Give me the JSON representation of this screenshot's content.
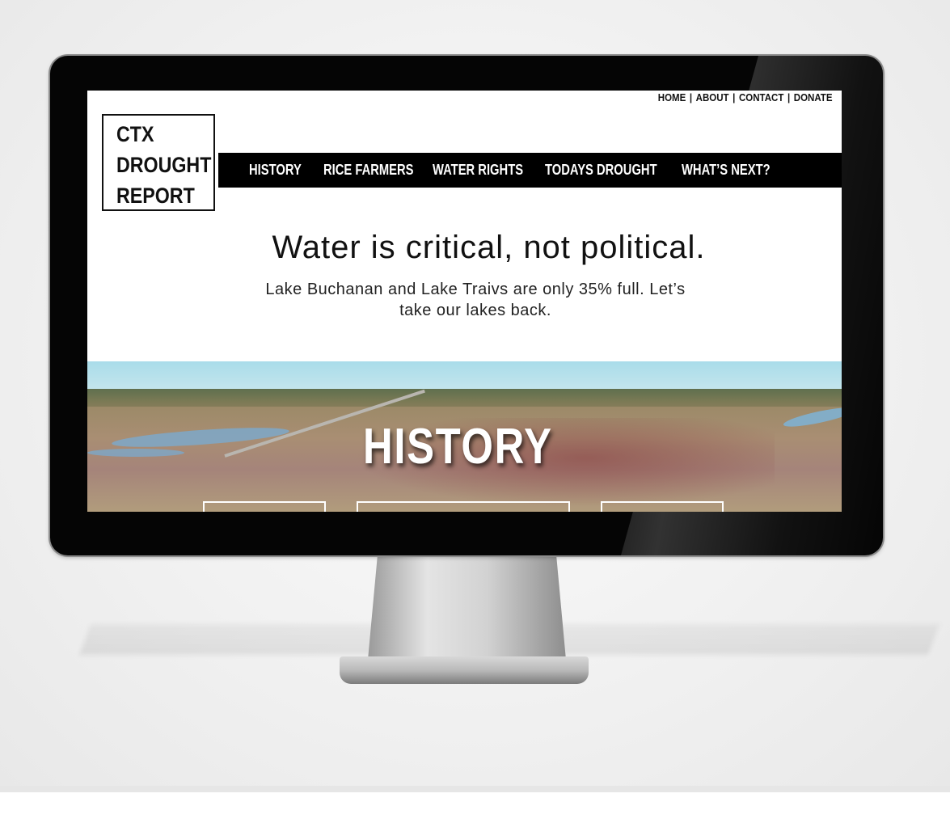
{
  "site": {
    "logo_lines": [
      "CTX",
      "DROUGHT",
      "REPORT"
    ]
  },
  "utility_nav": {
    "items": [
      "HOME",
      "ABOUT",
      "CONTACT",
      "DONATE"
    ],
    "separator": "|"
  },
  "main_nav": {
    "items": [
      "HISTORY",
      "RICE FARMERS",
      "WATER RIGHTS",
      "TODAYS DROUGHT",
      "WHAT’S NEXT?"
    ]
  },
  "intro": {
    "headline": "Water is critical, not political.",
    "subtext": "Lake Buchanan and Lake Traivs are only 35% full. Let’s take our lakes back."
  },
  "hero": {
    "title": "HISTORY"
  },
  "colors": {
    "nav_bg": "#000000",
    "nav_text": "#ffffff",
    "text": "#111111",
    "monitor_bezel": "#050505"
  }
}
